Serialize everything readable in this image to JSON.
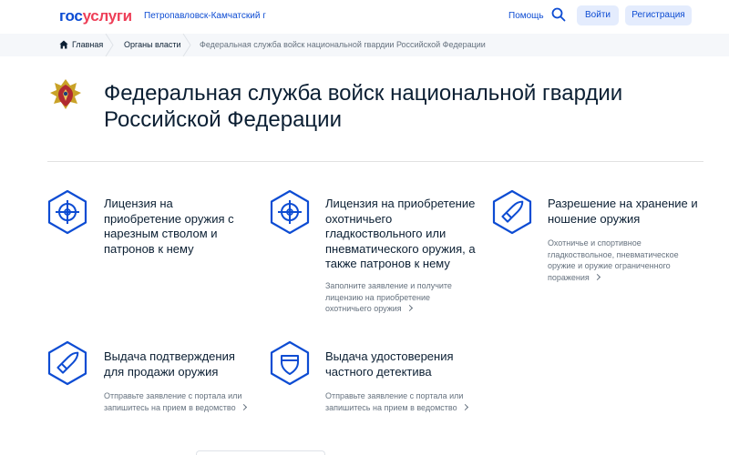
{
  "header": {
    "logo_part1": "гос",
    "logo_part2": "услуги",
    "city": "Петропавловск-Камчатский г",
    "help": "Помощь",
    "login": "Войти",
    "register": "Регистрация",
    "colors": {
      "brand_blue": "#0d4cd3",
      "brand_red": "#ee3f58",
      "button_bg": "#e4ecfd"
    }
  },
  "breadcrumbs": {
    "home": "Главная",
    "organs": "Органы власти",
    "current": "Федеральная служба войск национальной гвардии Российской Федерации"
  },
  "page": {
    "title": "Федеральная служба войск национальной гвардии Российской Федерации"
  },
  "services": [
    {
      "icon": "crosshair-icon",
      "title": "Лицензия на приобретение оружия с нарезным стволом и патронов к нему",
      "desc": ""
    },
    {
      "icon": "crosshair-icon",
      "title": "Лицензия на приобретение охотничьего гладкоствольного или пневматического оружия, а также патронов к нему",
      "desc": "Заполните заявление и получите лицензию на приобретение охотничьего оружия"
    },
    {
      "icon": "bullet-icon",
      "title": "Разрешение на хранение и ношение оружия",
      "desc": "Охотничье и спортивное гладкоствольное, пневматическое оружие и оружие ограниченного поражения"
    },
    {
      "icon": "bullet-icon",
      "title": "Выдача подтверждения для продажи оружия",
      "desc": "Отправьте заявление с портала или запишитесь на прием в ведомство"
    },
    {
      "icon": "shield-icon",
      "title": "Выдача удостоверения частного детектива",
      "desc": "Отправьте заявление с портала или запишитесь на прием в ведомство"
    }
  ]
}
